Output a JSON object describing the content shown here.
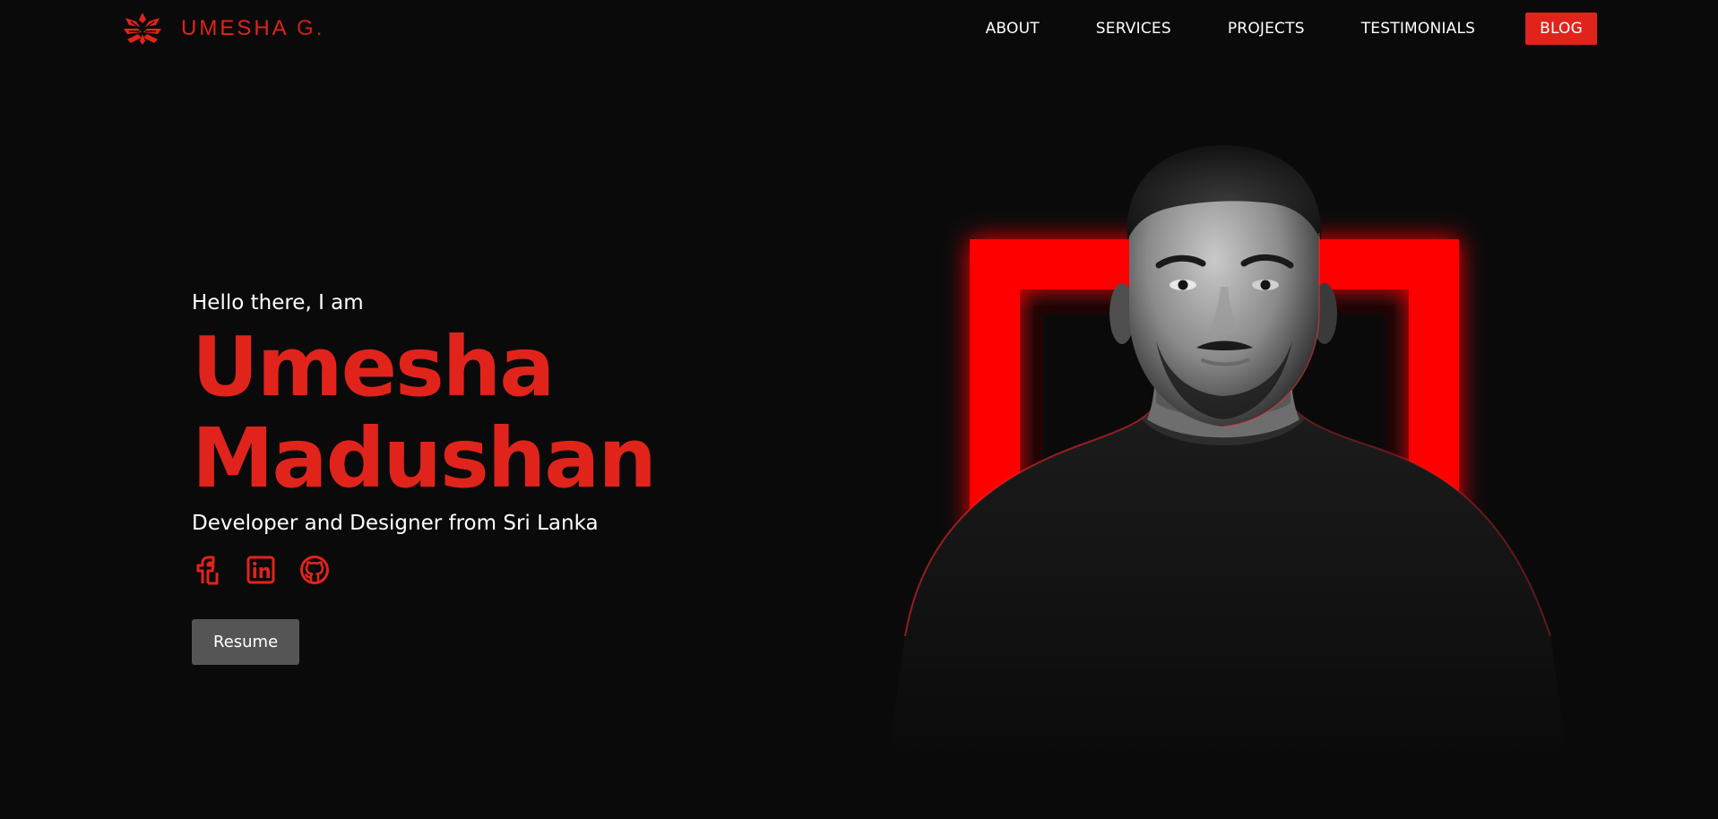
{
  "brand": {
    "name": "UMESHA",
    "suffix": "G.",
    "accent": "#e0241b"
  },
  "nav": {
    "items": [
      "ABOUT",
      "SERVICES",
      "PROJECTS",
      "TESTIMONIALS"
    ],
    "cta": "BLOG"
  },
  "hero": {
    "greeting": "Hello there, I am",
    "first_name": "Umesha",
    "last_name": "Madushan",
    "tagline": "Developer and Designer from Sri Lanka",
    "resume_label": "Resume"
  },
  "socials": [
    "facebook-icon",
    "linkedin-icon",
    "github-icon"
  ],
  "colors": {
    "background": "#0a0a0b",
    "accent": "#e0241b",
    "button": "#555555"
  }
}
